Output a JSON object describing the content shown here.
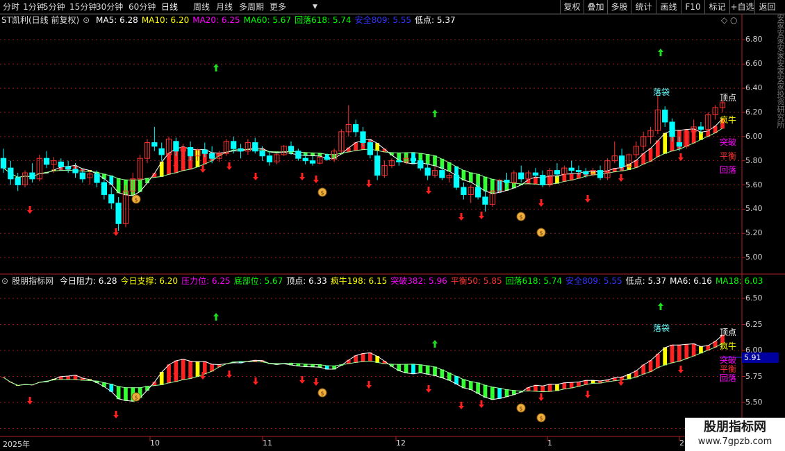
{
  "toolbar": {
    "periods": [
      "分时",
      "1分钟",
      "5分钟",
      "15分钟",
      "30分钟",
      "60分钟",
      "日线",
      "周线",
      "月线",
      "多周期",
      "更多"
    ],
    "active_period": "日线",
    "right_buttons": [
      "复权",
      "叠加",
      "多股",
      "统计",
      "画线",
      "F10",
      "标记",
      "+自选",
      "返回"
    ]
  },
  "main_header": {
    "title": "ST凯利(日线 前复权)",
    "items": [
      {
        "label": "MA5: 6.28",
        "color": "#ffffff"
      },
      {
        "label": "MA10: 6.20",
        "color": "#ffff00"
      },
      {
        "label": "MA20: 6.25",
        "color": "#ff00ff"
      },
      {
        "label": "MA60: 5.67",
        "color": "#00ff00"
      },
      {
        "label": "回落618: 5.74",
        "color": "#00ff00"
      },
      {
        "label": "安全809: 5.55",
        "color": "#3333ff"
      },
      {
        "label": "低点: 5.37",
        "color": "#ffffff"
      }
    ]
  },
  "indicator_header": {
    "title": "股朋指标网",
    "items": [
      {
        "label": "今日阻力: 6.28",
        "color": "#ffffff"
      },
      {
        "label": "今日支撑: 6.20",
        "color": "#ffff00"
      },
      {
        "label": "压力位: 6.25",
        "color": "#ff00ff"
      },
      {
        "label": "底部位: 5.67",
        "color": "#00ff00"
      },
      {
        "label": "顶点: 6.33",
        "color": "#ffffff"
      },
      {
        "label": "疯牛198: 6.15",
        "color": "#ffff00"
      },
      {
        "label": "突破382: 5.96",
        "color": "#ff00ff"
      },
      {
        "label": "平衡50: 5.85",
        "color": "#ff3333"
      },
      {
        "label": "回落618: 5.74",
        "color": "#00ff00"
      },
      {
        "label": "安全809: 5.55",
        "color": "#3333ff"
      },
      {
        "label": "低点: 5.37",
        "color": "#ffffff"
      },
      {
        "label": "MA6: 6.16",
        "color": "#ffffff"
      },
      {
        "label": "MA18: 6.03",
        "color": "#00ff00"
      }
    ]
  },
  "right_labels": {
    "luodai": "落袋",
    "dingdian": "顶点",
    "fengniu": "疯牛",
    "tupo": "突破",
    "pingheng": "平衡",
    "huiluo": "回落"
  },
  "main_axis_labels": [
    "6.80",
    "6.60",
    "6.40",
    "6.20",
    "6.00",
    "5.80",
    "5.60",
    "5.40",
    "5.20",
    "5.00"
  ],
  "main_axis_values": [
    6.8,
    6.6,
    6.4,
    6.2,
    6.0,
    5.8,
    5.6,
    5.4,
    5.2,
    5.0
  ],
  "ind_axis_labels": [
    "6.50",
    "6.25",
    "6.00",
    "5.75",
    "5.50",
    "5.25"
  ],
  "ind_axis_values": [
    6.5,
    6.25,
    6.0,
    5.75,
    5.5,
    5.25
  ],
  "ind_price_box": "5.91",
  "date_labels": [
    "2025年",
    "10",
    "11",
    "12",
    "1",
    "2"
  ],
  "side_text": "安家安家安家安家安家投资研究所",
  "watermark": {
    "name": "股朋指标网",
    "url": "www.7gpzb.com"
  },
  "colors": {
    "up": "#ff3232",
    "down": "#00ffff",
    "band_green": "#33ff33",
    "band_red": "#ff2222",
    "band_yellow": "#ffff00",
    "band_cyan": "#00ffff",
    "grid": "#8a2020"
  },
  "chart_data": {
    "type": "candlestick",
    "x_start": "2025年",
    "ohlc": [
      [
        5.82,
        5.9,
        5.7,
        5.74
      ],
      [
        5.74,
        5.8,
        5.6,
        5.65
      ],
      [
        5.66,
        5.7,
        5.55,
        5.6
      ],
      [
        5.6,
        5.72,
        5.58,
        5.7
      ],
      [
        5.7,
        5.78,
        5.62,
        5.65
      ],
      [
        5.65,
        5.85,
        5.63,
        5.82
      ],
      [
        5.82,
        5.88,
        5.74,
        5.77
      ],
      [
        5.77,
        5.83,
        5.7,
        5.8
      ],
      [
        5.79,
        5.82,
        5.72,
        5.75
      ],
      [
        5.75,
        5.8,
        5.7,
        5.73
      ],
      [
        5.73,
        5.78,
        5.66,
        5.7
      ],
      [
        5.7,
        5.74,
        5.62,
        5.65
      ],
      [
        5.66,
        5.72,
        5.6,
        5.69
      ],
      [
        5.69,
        5.72,
        5.58,
        5.62
      ],
      [
        5.62,
        5.66,
        5.48,
        5.52
      ],
      [
        5.52,
        5.58,
        5.4,
        5.45
      ],
      [
        5.45,
        5.5,
        5.22,
        5.28
      ],
      [
        5.28,
        5.6,
        5.25,
        5.55
      ],
      [
        5.55,
        5.7,
        5.52,
        5.65
      ],
      [
        5.65,
        5.85,
        5.63,
        5.82
      ],
      [
        5.82,
        5.98,
        5.78,
        5.95
      ],
      [
        5.95,
        6.08,
        5.88,
        5.92
      ],
      [
        5.9,
        5.95,
        5.8,
        5.85
      ],
      [
        5.85,
        6.0,
        5.83,
        5.98
      ],
      [
        5.96,
        5.99,
        5.84,
        5.88
      ],
      [
        5.88,
        5.94,
        5.82,
        5.91
      ],
      [
        5.91,
        5.96,
        5.8,
        5.84
      ],
      [
        5.84,
        5.9,
        5.8,
        5.89
      ],
      [
        5.89,
        5.95,
        5.83,
        5.86
      ],
      [
        5.86,
        5.92,
        5.78,
        5.82
      ],
      [
        5.82,
        5.88,
        5.79,
        5.86
      ],
      [
        5.86,
        5.98,
        5.84,
        5.96
      ],
      [
        5.96,
        6.0,
        5.86,
        5.9
      ],
      [
        5.9,
        5.94,
        5.82,
        5.88
      ],
      [
        5.88,
        5.98,
        5.85,
        5.95
      ],
      [
        5.95,
        5.99,
        5.86,
        5.88
      ],
      [
        5.88,
        5.92,
        5.8,
        5.84
      ],
      [
        5.84,
        5.88,
        5.76,
        5.79
      ],
      [
        5.79,
        5.86,
        5.77,
        5.85
      ],
      [
        5.85,
        5.93,
        5.84,
        5.92
      ],
      [
        5.92,
        5.96,
        5.85,
        5.88
      ],
      [
        5.88,
        5.9,
        5.8,
        5.82
      ],
      [
        5.82,
        5.86,
        5.77,
        5.8
      ],
      [
        5.8,
        5.84,
        5.76,
        5.78
      ],
      [
        5.78,
        5.84,
        5.77,
        5.83
      ],
      [
        5.83,
        5.86,
        5.8,
        5.81
      ],
      [
        5.81,
        5.9,
        5.79,
        5.88
      ],
      [
        5.88,
        6.06,
        5.86,
        6.04
      ],
      [
        6.04,
        6.26,
        6.0,
        6.1
      ],
      [
        6.1,
        6.14,
        6.0,
        6.04
      ],
      [
        6.04,
        6.08,
        5.92,
        5.95
      ],
      [
        5.95,
        5.98,
        5.82,
        5.85
      ],
      [
        5.84,
        5.88,
        5.64,
        5.68
      ],
      [
        5.68,
        5.8,
        5.66,
        5.76
      ],
      [
        5.76,
        5.82,
        5.74,
        5.8
      ],
      [
        5.8,
        5.84,
        5.76,
        5.79
      ],
      [
        5.79,
        5.85,
        5.77,
        5.82
      ],
      [
        5.82,
        5.85,
        5.78,
        5.8
      ],
      [
        5.8,
        5.82,
        5.72,
        5.74
      ],
      [
        5.74,
        5.78,
        5.64,
        5.68
      ],
      [
        5.68,
        5.75,
        5.66,
        5.72
      ],
      [
        5.72,
        5.76,
        5.64,
        5.66
      ],
      [
        5.66,
        5.7,
        5.62,
        5.68
      ],
      [
        5.68,
        5.72,
        5.56,
        5.58
      ],
      [
        5.58,
        5.62,
        5.48,
        5.52
      ],
      [
        5.52,
        5.6,
        5.45,
        5.58
      ],
      [
        5.58,
        5.62,
        5.48,
        5.5
      ],
      [
        5.5,
        5.56,
        5.38,
        5.44
      ],
      [
        5.44,
        5.56,
        5.42,
        5.55
      ],
      [
        5.55,
        5.65,
        5.53,
        5.64
      ],
      [
        5.64,
        5.7,
        5.58,
        5.62
      ],
      [
        5.62,
        5.72,
        5.6,
        5.7
      ],
      [
        5.7,
        5.76,
        5.62,
        5.65
      ],
      [
        5.65,
        5.72,
        5.63,
        5.7
      ],
      [
        5.7,
        5.74,
        5.66,
        5.68
      ],
      [
        5.68,
        5.72,
        5.58,
        5.6
      ],
      [
        5.6,
        5.74,
        5.58,
        5.72
      ],
      [
        5.72,
        5.78,
        5.66,
        5.69
      ],
      [
        5.69,
        5.76,
        5.67,
        5.74
      ],
      [
        5.74,
        5.8,
        5.7,
        5.72
      ],
      [
        5.72,
        5.76,
        5.68,
        5.71
      ],
      [
        5.71,
        5.74,
        5.66,
        5.69
      ],
      [
        5.69,
        5.74,
        5.67,
        5.72
      ],
      [
        5.72,
        5.76,
        5.64,
        5.66
      ],
      [
        5.66,
        5.82,
        5.64,
        5.8
      ],
      [
        5.8,
        5.96,
        5.78,
        5.84
      ],
      [
        5.84,
        5.9,
        5.72,
        5.75
      ],
      [
        5.75,
        5.86,
        5.74,
        5.85
      ],
      [
        5.85,
        5.96,
        5.82,
        5.92
      ],
      [
        5.92,
        6.04,
        5.88,
        6.0
      ],
      [
        6.0,
        6.08,
        5.94,
        6.05
      ],
      [
        6.05,
        6.34,
        6.02,
        6.22
      ],
      [
        6.22,
        6.25,
        6.08,
        6.12
      ],
      [
        6.12,
        6.15,
        5.96,
        6.0
      ],
      [
        5.95,
        6.0,
        5.88,
        5.92
      ],
      [
        5.92,
        6.05,
        5.9,
        6.04
      ],
      [
        6.04,
        6.14,
        6.02,
        6.08
      ],
      [
        6.08,
        6.12,
        6.02,
        6.06
      ],
      [
        6.06,
        6.2,
        6.04,
        6.18
      ],
      [
        6.18,
        6.26,
        6.14,
        6.24
      ],
      [
        6.24,
        6.3,
        6.2,
        6.28
      ]
    ]
  }
}
